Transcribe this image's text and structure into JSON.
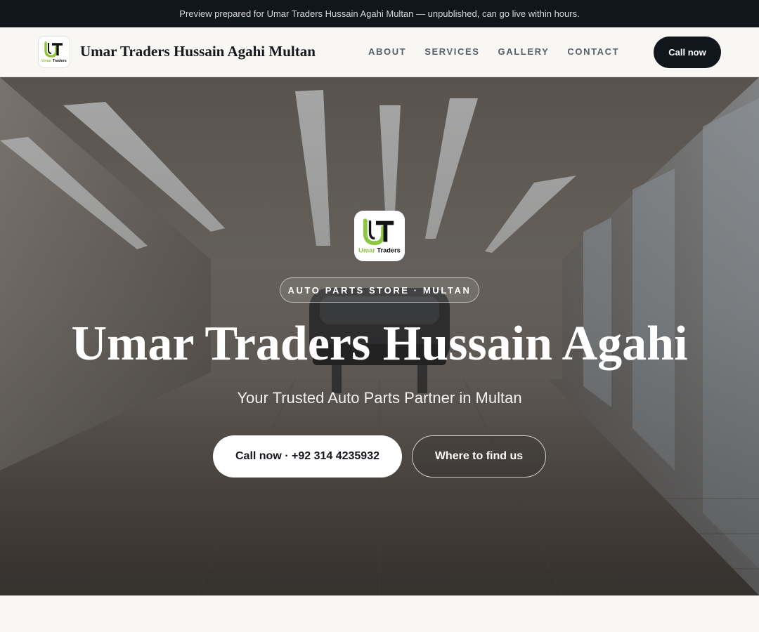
{
  "preview_banner": {
    "text": "Preview prepared for Umar Traders Hussain Agahi Multan — unpublished, can go live within hours."
  },
  "header": {
    "logo_icon": "umar-traders-logo",
    "brand_name": "Umar Traders Hussain Agahi Multan",
    "nav": [
      {
        "label": "ABOUT"
      },
      {
        "label": "SERVICES"
      },
      {
        "label": "GALLERY"
      },
      {
        "label": "CONTACT"
      }
    ],
    "cta_label": "Call now"
  },
  "logo": {
    "initials": "UT",
    "wordmark": "Umar Traders"
  },
  "hero": {
    "background": "auto-workshop-photo",
    "badge": "AUTO PARTS STORE · MULTAN",
    "title": "Umar Traders Hussain Agahi",
    "subtitle": "Your Trusted Auto Parts Partner in Multan",
    "primary_button": "Call now · +92 314 4235932",
    "secondary_button": "Where to find us"
  },
  "colors": {
    "topbar": "#11151c",
    "navbar": "#f8f7f4",
    "brand_text": "#15181d",
    "nav_text": "#56606b",
    "logo_green": "#8dc63f"
  }
}
